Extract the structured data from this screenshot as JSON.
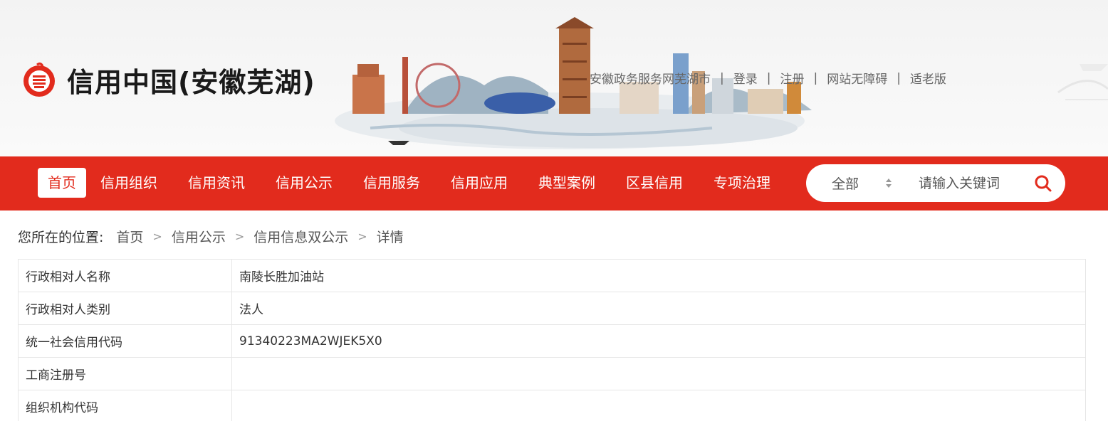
{
  "header": {
    "logo_text": "信用中国(安徽芜湖)",
    "links": [
      "安徽政务服务网芜湖市",
      "登录",
      "注册",
      "网站无障碍",
      "适老版"
    ],
    "link_separator": "|"
  },
  "nav": {
    "items": [
      "首页",
      "信用组织",
      "信用资讯",
      "信用公示",
      "信用服务",
      "信用应用",
      "典型案例",
      "区县信用",
      "专项治理"
    ],
    "active_index": 0
  },
  "search": {
    "select_value": "全部",
    "placeholder": "请输入关键词",
    "icon": "search-icon"
  },
  "breadcrumb": {
    "lead": "您所在的位置:",
    "items": [
      "首页",
      "信用公示",
      "信用信息双公示",
      "详情"
    ],
    "separator": ">"
  },
  "detail": {
    "rows": [
      {
        "label": "行政相对人名称",
        "value": "南陵长胜加油站"
      },
      {
        "label": "行政相对人类别",
        "value": "法人"
      },
      {
        "label": "统一社会信用代码",
        "value": "91340223MA2WJEK5X0"
      },
      {
        "label": "工商注册号",
        "value": ""
      },
      {
        "label": "组织机构代码",
        "value": ""
      }
    ]
  },
  "colors": {
    "brand_red": "#e22b1d",
    "text": "#333333",
    "border": "#e6e6e6"
  }
}
